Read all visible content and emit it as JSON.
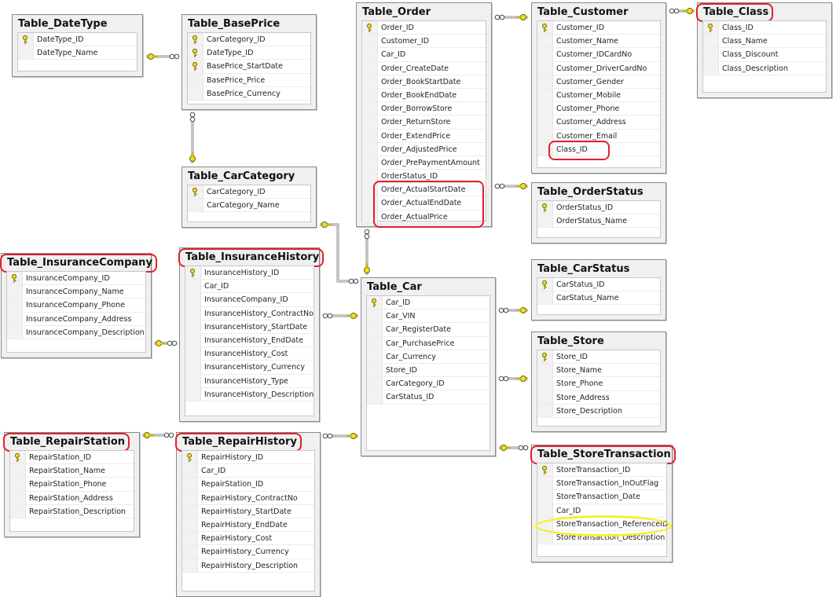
{
  "diagram": {
    "type": "database-er-diagram",
    "colors": {
      "highlight_red": "#e0202a",
      "highlight_yellow": "#f5f02a",
      "key_icon": "#f0e020",
      "connector": "#8a8a8a"
    },
    "tables": [
      {
        "id": "datetype",
        "title": "Table_DateType",
        "columns": [
          {
            "name": "DateType_ID",
            "pk": true
          },
          {
            "name": "DateType_Name",
            "pk": false
          }
        ]
      },
      {
        "id": "baseprice",
        "title": "Table_BasePrice",
        "columns": [
          {
            "name": "CarCategory_ID",
            "pk": true
          },
          {
            "name": "DateType_ID",
            "pk": true
          },
          {
            "name": "BasePrice_StartDate",
            "pk": true
          },
          {
            "name": "BasePrice_Price",
            "pk": false
          },
          {
            "name": "BasePrice_Currency",
            "pk": false
          }
        ]
      },
      {
        "id": "order",
        "title": "Table_Order",
        "columns": [
          {
            "name": "Order_ID",
            "pk": true
          },
          {
            "name": "Customer_ID",
            "pk": false
          },
          {
            "name": "Car_ID",
            "pk": false
          },
          {
            "name": "Order_CreateDate",
            "pk": false
          },
          {
            "name": "Order_BookStartDate",
            "pk": false
          },
          {
            "name": "Order_BookEndDate",
            "pk": false
          },
          {
            "name": "Order_BorrowStore",
            "pk": false
          },
          {
            "name": "Order_ReturnStore",
            "pk": false
          },
          {
            "name": "Order_ExtendPrice",
            "pk": false
          },
          {
            "name": "Order_AdjustedPrice",
            "pk": false
          },
          {
            "name": "Order_PrePaymentAmount",
            "pk": false
          },
          {
            "name": "OrderStatus_ID",
            "pk": false
          },
          {
            "name": "Order_ActualStartDate",
            "pk": false
          },
          {
            "name": "Order_ActualEndDate",
            "pk": false
          },
          {
            "name": "Order_ActualPrice",
            "pk": false
          }
        ]
      },
      {
        "id": "customer",
        "title": "Table_Customer",
        "columns": [
          {
            "name": "Customer_ID",
            "pk": true
          },
          {
            "name": "Customer_Name",
            "pk": false
          },
          {
            "name": "Customer_IDCardNo",
            "pk": false
          },
          {
            "name": "Customer_DriverCardNo",
            "pk": false
          },
          {
            "name": "Customer_Gender",
            "pk": false
          },
          {
            "name": "Customer_Mobile",
            "pk": false
          },
          {
            "name": "Customer_Phone",
            "pk": false
          },
          {
            "name": "Customer_Address",
            "pk": false
          },
          {
            "name": "Customer_Email",
            "pk": false
          },
          {
            "name": "Class_ID",
            "pk": false
          }
        ]
      },
      {
        "id": "class",
        "title": "Table_Class",
        "highlighted": true,
        "columns": [
          {
            "name": "Class_ID",
            "pk": true
          },
          {
            "name": "Class_Name",
            "pk": false
          },
          {
            "name": "Class_Discount",
            "pk": false
          },
          {
            "name": "Class_Description",
            "pk": false
          }
        ]
      },
      {
        "id": "carcategory",
        "title": "Table_CarCategory",
        "columns": [
          {
            "name": "CarCategory_ID",
            "pk": true
          },
          {
            "name": "CarCategory_Name",
            "pk": false
          }
        ]
      },
      {
        "id": "orderstatus",
        "title": "Table_OrderStatus",
        "columns": [
          {
            "name": "OrderStatus_ID",
            "pk": true
          },
          {
            "name": "OrderStatus_Name",
            "pk": false
          }
        ]
      },
      {
        "id": "insurancecompany",
        "title": "Table_InsuranceCompany",
        "highlighted": true,
        "columns": [
          {
            "name": "InsuranceCompany_ID",
            "pk": true
          },
          {
            "name": "InsuranceCompany_Name",
            "pk": false
          },
          {
            "name": "InsuranceCompany_Phone",
            "pk": false
          },
          {
            "name": "InsuranceCompany_Address",
            "pk": false
          },
          {
            "name": "InsuranceCompany_Description",
            "pk": false
          }
        ]
      },
      {
        "id": "insurancehistory",
        "title": "Table_InsuranceHistory",
        "highlighted": true,
        "columns": [
          {
            "name": "InsuranceHistory_ID",
            "pk": true
          },
          {
            "name": "Car_ID",
            "pk": false
          },
          {
            "name": "InsuranceCompany_ID",
            "pk": false
          },
          {
            "name": "InsuranceHistory_ContractNo",
            "pk": false
          },
          {
            "name": "InsuranceHistory_StartDate",
            "pk": false
          },
          {
            "name": "InsuranceHistory_EndDate",
            "pk": false
          },
          {
            "name": "InsuranceHistory_Cost",
            "pk": false
          },
          {
            "name": "InsuranceHistory_Currency",
            "pk": false
          },
          {
            "name": "InsuranceHistory_Type",
            "pk": false
          },
          {
            "name": "InsuranceHistory_Description",
            "pk": false
          }
        ]
      },
      {
        "id": "car",
        "title": "Table_Car",
        "columns": [
          {
            "name": "Car_ID",
            "pk": true
          },
          {
            "name": "Car_VIN",
            "pk": false
          },
          {
            "name": "Car_RegisterDate",
            "pk": false
          },
          {
            "name": "Car_PurchasePrice",
            "pk": false
          },
          {
            "name": "Car_Currency",
            "pk": false
          },
          {
            "name": "Store_ID",
            "pk": false
          },
          {
            "name": "CarCategory_ID",
            "pk": false
          },
          {
            "name": "CarStatus_ID",
            "pk": false
          }
        ]
      },
      {
        "id": "carstatus",
        "title": "Table_CarStatus",
        "columns": [
          {
            "name": "CarStatus_ID",
            "pk": true
          },
          {
            "name": "CarStatus_Name",
            "pk": false
          }
        ]
      },
      {
        "id": "store",
        "title": "Table_Store",
        "columns": [
          {
            "name": "Store_ID",
            "pk": true
          },
          {
            "name": "Store_Name",
            "pk": false
          },
          {
            "name": "Store_Phone",
            "pk": false
          },
          {
            "name": "Store_Address",
            "pk": false
          },
          {
            "name": "Store_Description",
            "pk": false
          }
        ]
      },
      {
        "id": "repairstation",
        "title": "Table_RepairStation",
        "highlighted": true,
        "columns": [
          {
            "name": "RepairStation_ID",
            "pk": true
          },
          {
            "name": "RepairStation_Name",
            "pk": false
          },
          {
            "name": "RepairStation_Phone",
            "pk": false
          },
          {
            "name": "RepairStation_Address",
            "pk": false
          },
          {
            "name": "RepairStation_Description",
            "pk": false
          }
        ]
      },
      {
        "id": "repairhistory",
        "title": "Table_RepairHistory",
        "highlighted": true,
        "columns": [
          {
            "name": "RepairHistory_ID",
            "pk": true
          },
          {
            "name": "Car_ID",
            "pk": false
          },
          {
            "name": "RepairStation_ID",
            "pk": false
          },
          {
            "name": "RepairHistory_ContractNo",
            "pk": false
          },
          {
            "name": "RepairHistory_StartDate",
            "pk": false
          },
          {
            "name": "RepairHistory_EndDate",
            "pk": false
          },
          {
            "name": "RepairHistory_Cost",
            "pk": false
          },
          {
            "name": "RepairHistory_Currency",
            "pk": false
          },
          {
            "name": "RepairHistory_Description",
            "pk": false
          }
        ]
      },
      {
        "id": "storetransaction",
        "title": "Table_StoreTransaction",
        "highlighted": true,
        "columns": [
          {
            "name": "StoreTransaction_ID",
            "pk": true
          },
          {
            "name": "StoreTransaction_InOutFlag",
            "pk": false
          },
          {
            "name": "StoreTransaction_Date",
            "pk": false
          },
          {
            "name": "Car_ID",
            "pk": false
          },
          {
            "name": "StoreTransaction_ReferenceID",
            "pk": false
          },
          {
            "name": "StoreTransaction_Description",
            "pk": false
          }
        ]
      }
    ],
    "relationships": [
      {
        "from": "datetype",
        "to": "baseprice",
        "one": "datetype",
        "many": "baseprice"
      },
      {
        "from": "carcategory",
        "to": "baseprice",
        "one": "carcategory",
        "many": "baseprice"
      },
      {
        "from": "customer",
        "to": "order",
        "one": "customer",
        "many": "order"
      },
      {
        "from": "class",
        "to": "customer",
        "one": "class",
        "many": "customer"
      },
      {
        "from": "orderstatus",
        "to": "order",
        "one": "orderstatus",
        "many": "order"
      },
      {
        "from": "car",
        "to": "order",
        "one": "car",
        "many": "order"
      },
      {
        "from": "carcategory",
        "to": "car",
        "one": "carcategory",
        "many": "car"
      },
      {
        "from": "car",
        "to": "insurancehistory",
        "one": "car",
        "many": "insurancehistory"
      },
      {
        "from": "insurancecompany",
        "to": "insurancehistory",
        "one": "insurancecompany",
        "many": "insurancehistory"
      },
      {
        "from": "carstatus",
        "to": "car",
        "one": "carstatus",
        "many": "car"
      },
      {
        "from": "store",
        "to": "car",
        "one": "store",
        "many": "car"
      },
      {
        "from": "car",
        "to": "storetransaction",
        "one": "car",
        "many": "storetransaction"
      },
      {
        "from": "repairstation",
        "to": "repairhistory",
        "one": "repairstation",
        "many": "repairhistory"
      },
      {
        "from": "car",
        "to": "repairhistory",
        "one": "car",
        "many": "repairhistory"
      }
    ],
    "annotations": [
      {
        "table": "order",
        "columns": [
          "Order_ActualStartDate",
          "Order_ActualEndDate",
          "Order_ActualPrice"
        ],
        "color": "red"
      },
      {
        "table": "customer",
        "columns": [
          "Class_ID"
        ],
        "color": "red"
      },
      {
        "table": "storetransaction",
        "columns": [
          "StoreTransaction_ReferenceID"
        ],
        "color": "yellow"
      }
    ]
  }
}
